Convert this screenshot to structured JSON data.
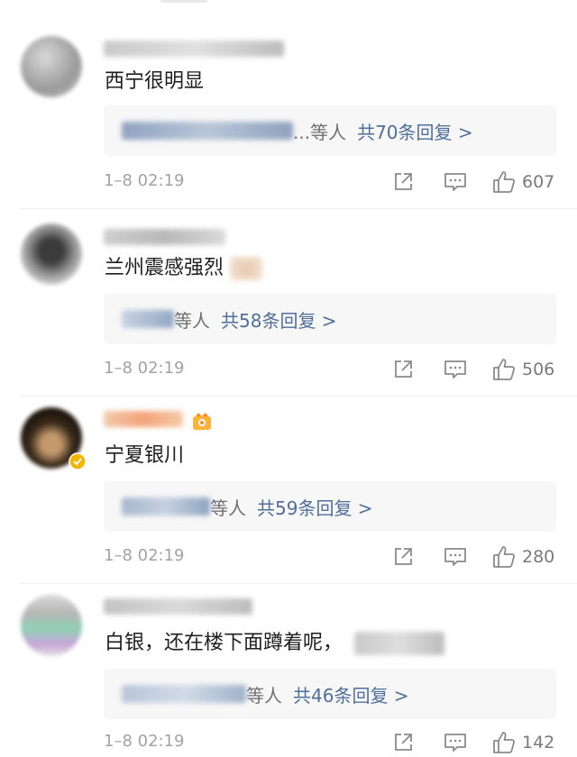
{
  "comments": [
    {
      "text": "西宁很明显",
      "reply_suffix": "...等人",
      "reply_count": "共70条回复 >",
      "timestamp": "1–8 02:19",
      "likes": "607"
    },
    {
      "text": "兰州震感强烈",
      "reply_suffix": "等人",
      "reply_count": "共58条回复 >",
      "timestamp": "1–8 02:19",
      "likes": "506"
    },
    {
      "text": "宁夏银川",
      "reply_suffix": "等人",
      "reply_count": "共59条回复 >",
      "timestamp": "1–8 02:19",
      "likes": "280"
    },
    {
      "text": "白银，还在楼下面蹲着呢，",
      "reply_suffix": "等人",
      "reply_count": "共46条回复 >",
      "timestamp": "1–8 02:19",
      "likes": "142"
    }
  ],
  "icons": {
    "share": "share-icon",
    "comment": "comment-icon",
    "like": "thumbs-up-icon",
    "badge": "fan-badge-icon"
  },
  "colors": {
    "reply_link": "#4f6e9a",
    "meta_text": "#a3a3a3",
    "reply_bg": "#f7f7f7"
  }
}
